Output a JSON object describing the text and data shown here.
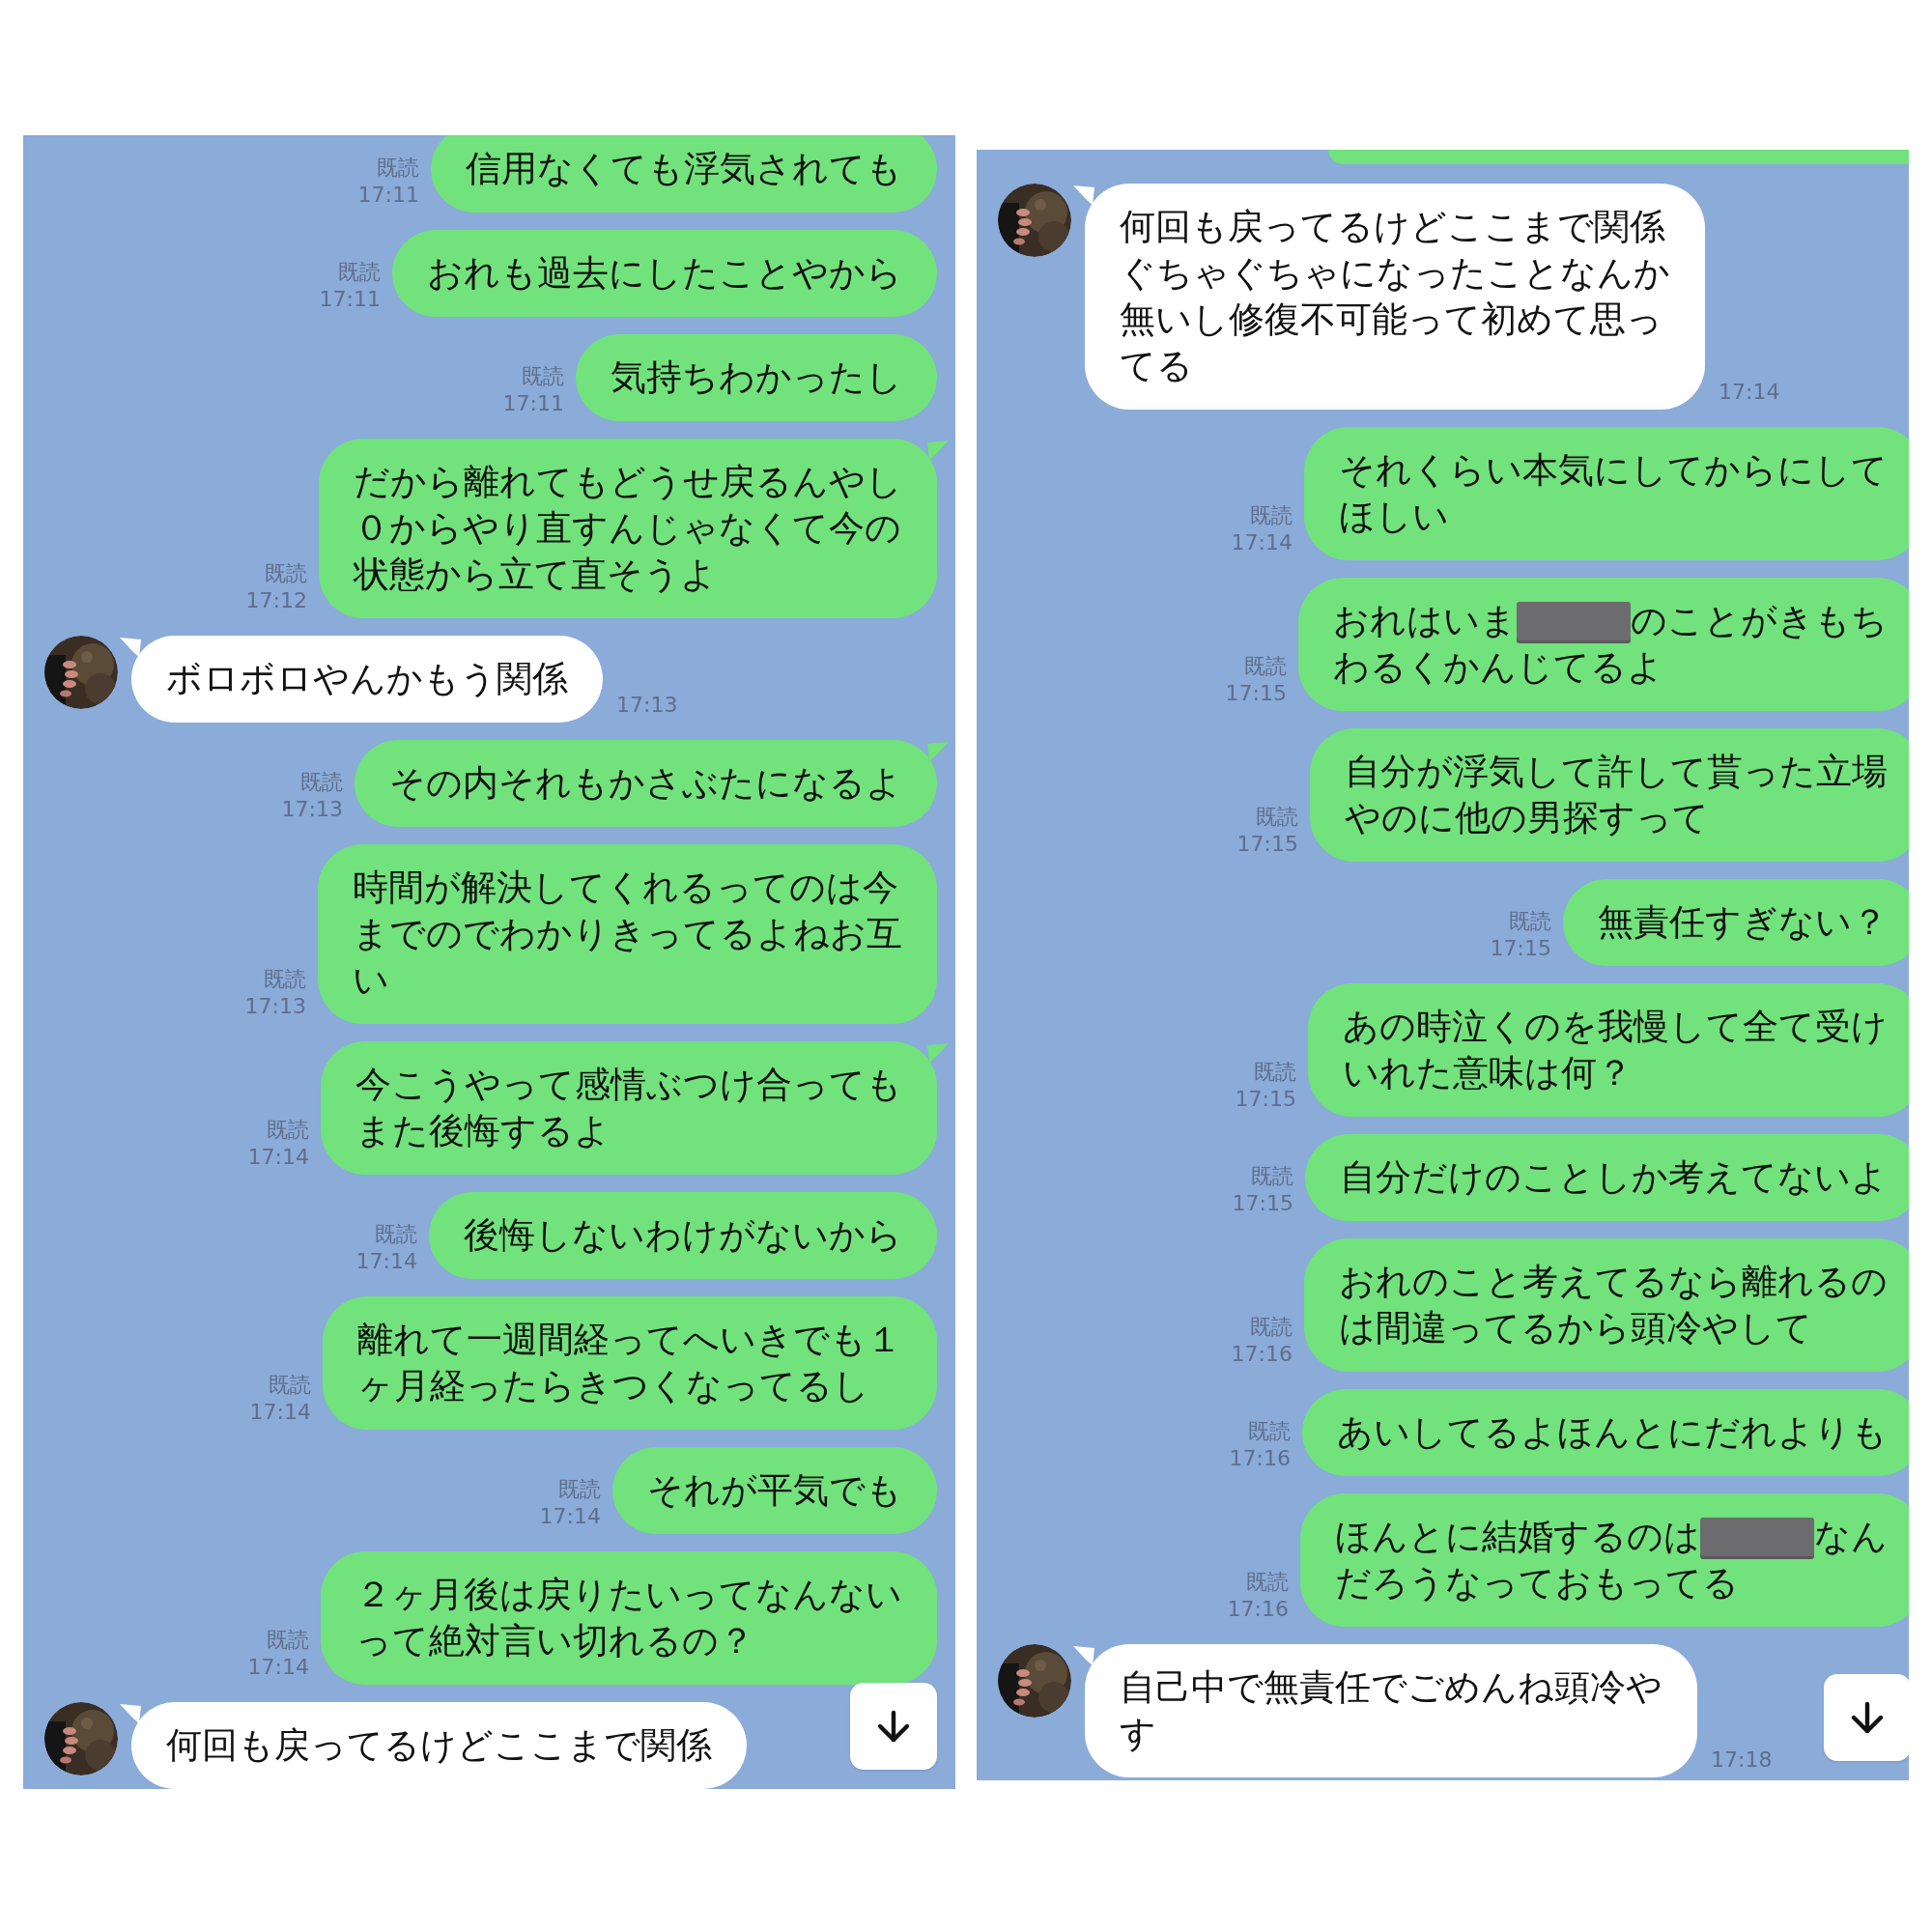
{
  "panels": [
    {
      "messages": [
        {
          "kind": "sent",
          "read_label": "既読",
          "time": "17:11",
          "tail": false,
          "lines": [
            "信用なくても浮気されても"
          ]
        },
        {
          "kind": "sent",
          "read_label": "既読",
          "time": "17:11",
          "tail": false,
          "lines": [
            "おれも過去にしたことやから"
          ]
        },
        {
          "kind": "sent",
          "read_label": "既読",
          "time": "17:11",
          "tail": false,
          "lines": [
            "気持ちわかったし"
          ]
        },
        {
          "kind": "sent",
          "read_label": "既読",
          "time": "17:12",
          "tail": true,
          "lines": [
            "だから離れてもどうせ戻るんやし",
            "０からやり直すんじゃなくて今の",
            "状態から立て直そうよ"
          ]
        },
        {
          "kind": "received",
          "time": "17:13",
          "lines": [
            "ボロボロやんかもう関係"
          ]
        },
        {
          "kind": "sent",
          "read_label": "既読",
          "time": "17:13",
          "tail": true,
          "lines": [
            "その内それもかさぶたになるよ"
          ]
        },
        {
          "kind": "sent",
          "read_label": "既読",
          "time": "17:13",
          "tail": false,
          "lines": [
            "時間が解決してくれるってのは今",
            "までのでわかりきってるよねお互",
            "い"
          ]
        },
        {
          "kind": "sent",
          "read_label": "既読",
          "time": "17:14",
          "tail": true,
          "lines": [
            "今こうやって感情ぶつけ合っても",
            "また後悔するよ"
          ]
        },
        {
          "kind": "sent",
          "read_label": "既読",
          "time": "17:14",
          "tail": false,
          "lines": [
            "後悔しないわけがないから"
          ]
        },
        {
          "kind": "sent",
          "read_label": "既読",
          "time": "17:14",
          "tail": false,
          "lines": [
            "離れて一週間経ってへいきでも１",
            "ヶ月経ったらきつくなってるし"
          ]
        },
        {
          "kind": "sent",
          "read_label": "既読",
          "time": "17:14",
          "tail": false,
          "lines": [
            "それが平気でも"
          ]
        },
        {
          "kind": "sent",
          "read_label": "既読",
          "time": "17:14",
          "tail": false,
          "lines": [
            "２ヶ月後は戻りたいってなんない",
            "って絶対言い切れるの？"
          ]
        },
        {
          "kind": "received",
          "lines": [
            "何回も戻ってるけどここまで関係"
          ]
        }
      ]
    },
    {
      "messages": [
        {
          "kind": "received",
          "time": "17:14",
          "lines": [
            "何回も戻ってるけどここまで関係",
            "ぐちゃぐちゃになったことなんか",
            "無いし修復不可能って初めて思っ",
            "てる"
          ]
        },
        {
          "kind": "sent",
          "read_label": "既読",
          "time": "17:14",
          "lines": [
            "それくらい本気にしてからにして",
            "ほしい"
          ]
        },
        {
          "kind": "sent",
          "read_label": "既読",
          "time": "17:15",
          "lines": [
            [
              {
                "kind": "text",
                "text": "おれはいま"
              },
              {
                "kind": "redaction"
              },
              {
                "kind": "text",
                "text": "のことがきもち"
              }
            ],
            "わるくかんじてるよ"
          ]
        },
        {
          "kind": "sent",
          "read_label": "既読",
          "time": "17:15",
          "lines": [
            "自分が浮気して許して貰った立場",
            "やのに他の男探すって"
          ]
        },
        {
          "kind": "sent",
          "read_label": "既読",
          "time": "17:15",
          "lines": [
            "無責任すぎない？"
          ]
        },
        {
          "kind": "sent",
          "read_label": "既読",
          "time": "17:15",
          "lines": [
            "あの時泣くのを我慢して全て受け",
            "いれた意味は何？"
          ]
        },
        {
          "kind": "sent",
          "read_label": "既読",
          "time": "17:15",
          "lines": [
            "自分だけのことしか考えてないよ"
          ]
        },
        {
          "kind": "sent",
          "read_label": "既読",
          "time": "17:16",
          "lines": [
            "おれのこと考えてるなら離れるの",
            "は間違ってるから頭冷やして"
          ]
        },
        {
          "kind": "sent",
          "read_label": "既読",
          "time": "17:16",
          "lines": [
            "あいしてるよほんとにだれよりも"
          ]
        },
        {
          "kind": "sent",
          "read_label": "既読",
          "time": "17:16",
          "lines": [
            [
              {
                "kind": "text",
                "text": "ほんとに結婚するのは"
              },
              {
                "kind": "redaction"
              },
              {
                "kind": "text",
                "text": "なん"
              }
            ],
            "だろうなっておもってる"
          ]
        },
        {
          "kind": "received",
          "time": "17:18",
          "lines": [
            "自己中で無責任でごめんね頭冷や",
            "す"
          ]
        }
      ]
    }
  ]
}
